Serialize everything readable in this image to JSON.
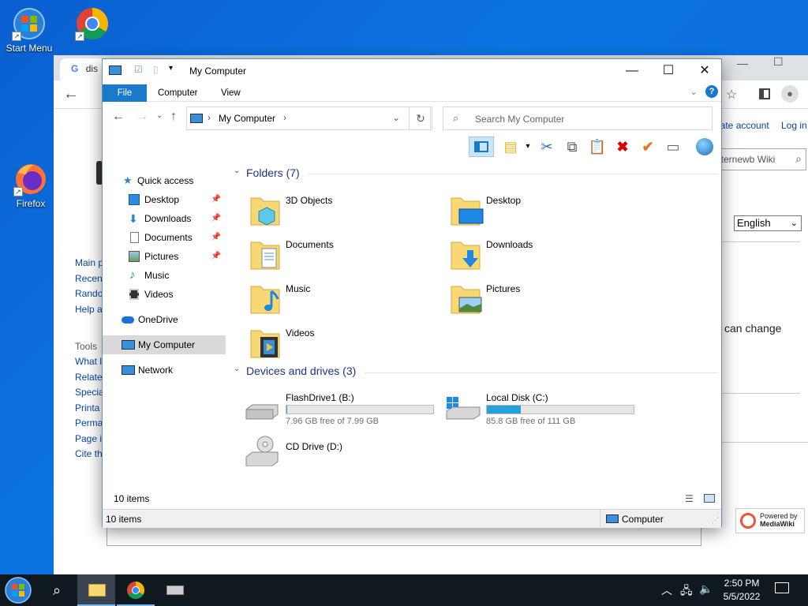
{
  "desktop": {
    "icons": [
      {
        "label": "Start Menu"
      },
      {
        "label": ""
      },
      {
        "label": "Firefox"
      }
    ]
  },
  "chrome": {
    "tab_title": "dis",
    "wiki_sidebar": [
      "Main p",
      "Recen",
      "Rando",
      "Help a",
      "",
      "Tools",
      "What l",
      "Relate",
      "Specia",
      "Printa",
      "Perma",
      "Page i",
      "Cite th"
    ],
    "create_account": "eate account",
    "log_in": "Log in",
    "search_placeholder": "iternewb Wiki",
    "language": "English",
    "body_snippet": "can change",
    "powered_by": "Powered by",
    "mediawiki": "MediaWiki"
  },
  "explorer": {
    "title": "My Computer",
    "ribbon_tabs": [
      "File",
      "Computer",
      "View"
    ],
    "address": "My Computer",
    "search_placeholder": "Search My Computer",
    "nav": {
      "quick_access": "Quick access",
      "desktop": "Desktop",
      "downloads": "Downloads",
      "documents": "Documents",
      "pictures": "Pictures",
      "music": "Music",
      "videos": "Videos",
      "onedrive": "OneDrive",
      "my_computer": "My Computer",
      "network": "Network"
    },
    "folders_header": "Folders (7)",
    "folders": [
      "3D Objects",
      "Desktop",
      "Documents",
      "Downloads",
      "Music",
      "Pictures",
      "Videos"
    ],
    "devices_header": "Devices and drives (3)",
    "drives": [
      {
        "name": "FlashDrive1 (B:)",
        "free": "7.96 GB free of 7.99 GB",
        "used_fraction": 0.004
      },
      {
        "name": "Local Disk (C:)",
        "free": "85.8 GB free of 111 GB",
        "used_fraction": 0.23
      },
      {
        "name": "CD Drive (D:)",
        "free": "",
        "used_fraction": 0
      }
    ],
    "item_count": "10 items",
    "status_count": "10 items",
    "status_location": "Computer"
  },
  "taskbar": {
    "time": "2:50 PM",
    "date": "5/5/2022"
  },
  "colors": {
    "accent": "#1979ca",
    "drive_fill": "#26a0da",
    "group_header": "#1e3287",
    "folder_yellow": "#f8d775"
  }
}
